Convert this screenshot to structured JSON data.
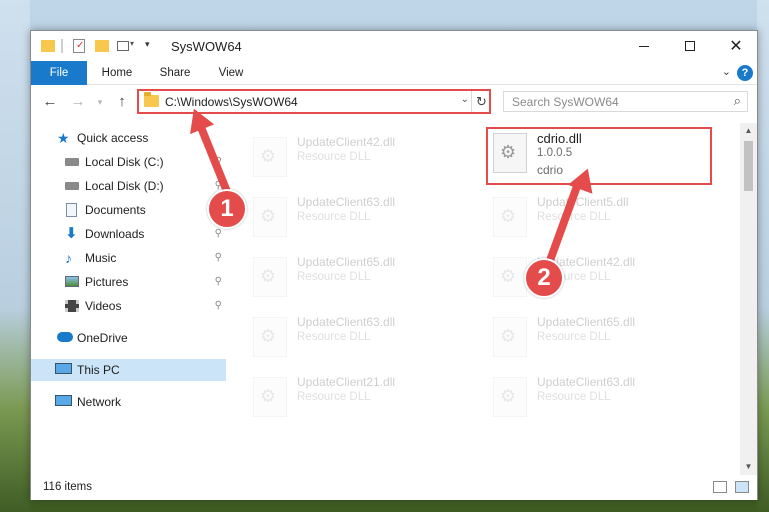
{
  "window": {
    "title": "SysWOW64",
    "tabs": [
      {
        "label": "File"
      },
      {
        "label": "Home"
      },
      {
        "label": "Share"
      },
      {
        "label": "View"
      }
    ]
  },
  "nav": {
    "address_path": "C:\\Windows\\SysWOW64",
    "search_placeholder": "Search SysWOW64"
  },
  "sidebar": {
    "items": [
      {
        "label": "Quick access",
        "icon": "star-icon",
        "pinned": false
      },
      {
        "label": "Local Disk (C:)",
        "icon": "drive-icon",
        "pinned": true
      },
      {
        "label": "Local Disk (D:)",
        "icon": "drive-icon",
        "pinned": true
      },
      {
        "label": "Documents",
        "icon": "document-icon",
        "pinned": true
      },
      {
        "label": "Downloads",
        "icon": "download-icon",
        "pinned": true
      },
      {
        "label": "Music",
        "icon": "music-icon",
        "pinned": true
      },
      {
        "label": "Pictures",
        "icon": "pictures-icon",
        "pinned": true
      },
      {
        "label": "Videos",
        "icon": "video-icon",
        "pinned": true
      },
      {
        "label": "OneDrive",
        "icon": "cloud-icon",
        "pinned": false
      },
      {
        "label": "This PC",
        "icon": "computer-icon",
        "pinned": false,
        "selected": true
      },
      {
        "label": "Network",
        "icon": "network-icon",
        "pinned": false
      }
    ]
  },
  "files": {
    "left_column": [
      {
        "name": "UpdateClient42.dll",
        "type": "Resource DLL"
      },
      {
        "name": "UpdateClient63.dll",
        "type": "Resource DLL"
      },
      {
        "name": "UpdateClient65.dll",
        "type": "Resource DLL"
      },
      {
        "name": "UpdateClient63.dll",
        "type": "Resource DLL"
      },
      {
        "name": "UpdateClient21.dll",
        "type": "Resource DLL"
      }
    ],
    "right_column": [
      {
        "name": "UpdateClient5.dll",
        "type": "Resource DLL"
      },
      {
        "name": "UpdateClient42.dll",
        "type": "Resource DLL"
      },
      {
        "name": "UpdateClient65.dll",
        "type": "Resource DLL"
      },
      {
        "name": "UpdateClient63.dll",
        "type": "Resource DLL"
      }
    ],
    "target": {
      "name": "cdrio.dll",
      "version": "1.0.0.5",
      "description": "cdrio"
    }
  },
  "status": {
    "item_count": "116 items"
  },
  "annotations": {
    "step1": "1",
    "step2": "2"
  },
  "colors": {
    "accent": "#1979ca",
    "highlight": "#e44b4b",
    "selected": "#cce4f7"
  }
}
